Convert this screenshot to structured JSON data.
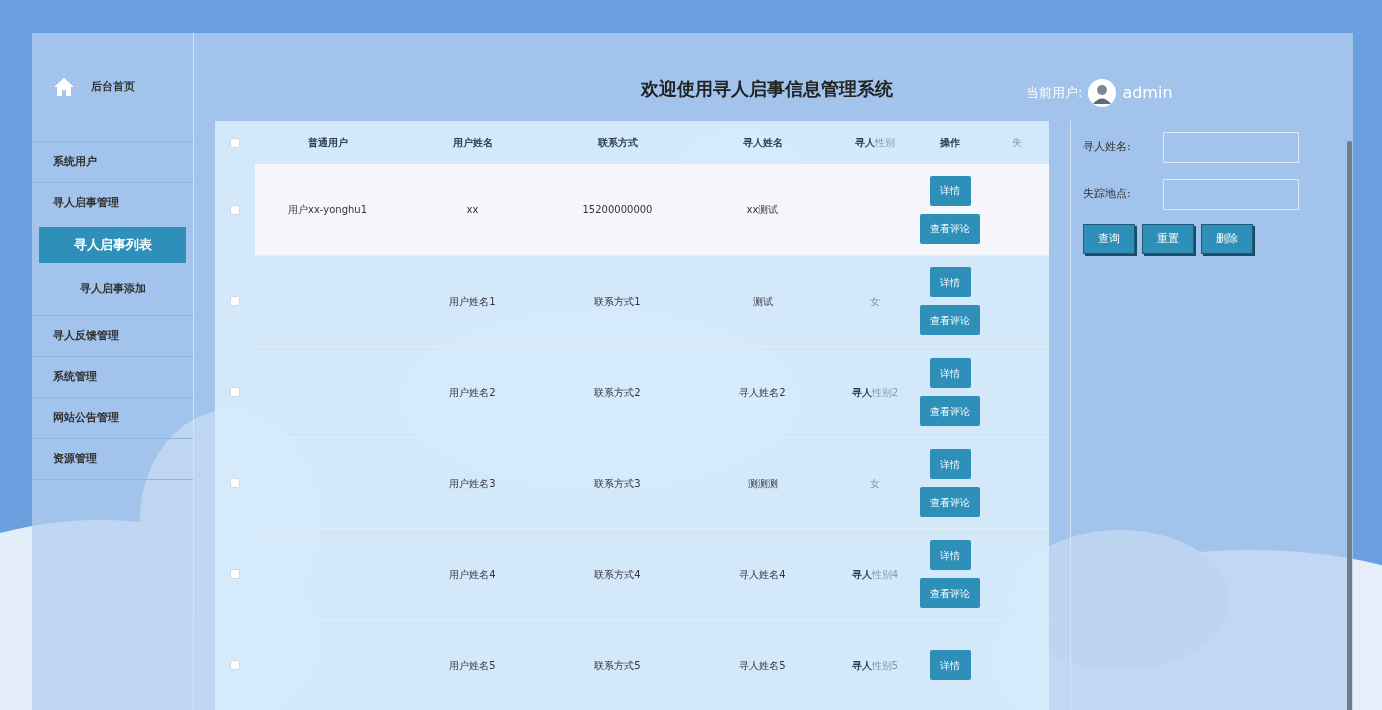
{
  "sidebar": {
    "home": "后台首页",
    "items": [
      {
        "label": "系统用户",
        "selected": false
      },
      {
        "label": "寻人启事管理",
        "selected": false,
        "children": [
          {
            "label": "寻人启事列表",
            "selected": true
          },
          {
            "label": "寻人启事添加",
            "selected": false
          }
        ]
      },
      {
        "label": "寻人反馈管理",
        "selected": false
      },
      {
        "label": "系统管理",
        "selected": false
      },
      {
        "label": "网站公告管理",
        "selected": false
      },
      {
        "label": "资源管理",
        "selected": false
      }
    ]
  },
  "header": {
    "title": "欢迎使用寻人启事信息管理系统",
    "user_label": "当前用户:",
    "user_name": "admin"
  },
  "table": {
    "select_all": {
      "checked": false
    },
    "columns": [
      {
        "label": "普通用户"
      },
      {
        "label": "用户姓名"
      },
      {
        "label": "联系方式"
      },
      {
        "label": "寻人姓名"
      },
      {
        "label": "寻人",
        "faint": "性别"
      },
      {
        "label": "操作"
      },
      {
        "faint": "失"
      }
    ],
    "rows": [
      {
        "selected": true,
        "checked": false,
        "user": "用户xx-yonghu1",
        "name": "xx",
        "contact": "15200000000",
        "missing": "xx测试",
        "actions": [
          "详情",
          "查看评论"
        ]
      },
      {
        "selected": false,
        "checked": false,
        "name": "用户姓名1",
        "contact": "联系方式1",
        "missing": "测试",
        "gender": {
          "faint": "女"
        },
        "actions": [
          "详情",
          "查看评论"
        ]
      },
      {
        "selected": false,
        "checked": false,
        "name": "用户姓名2",
        "contact": "联系方式2",
        "missing": "寻人姓名2",
        "gender": {
          "strong": "寻人",
          "faint": "性别2"
        },
        "actions": [
          "详情",
          "查看评论"
        ]
      },
      {
        "selected": false,
        "checked": false,
        "name": "用户姓名3",
        "contact": "联系方式3",
        "missing": "测测测",
        "gender": {
          "faint": "女"
        },
        "actions": [
          "详情",
          "查看评论"
        ]
      },
      {
        "selected": false,
        "checked": false,
        "name": "用户姓名4",
        "contact": "联系方式4",
        "missing": "寻人姓名4",
        "gender": {
          "strong": "寻人",
          "faint": "性别4"
        },
        "actions": [
          "详情",
          "查看评论"
        ]
      },
      {
        "selected": false,
        "checked": false,
        "name": "用户姓名5",
        "contact": "联系方式5",
        "missing": "寻人姓名5",
        "gender": {
          "strong": "寻人",
          "faint": "性别5"
        },
        "actions": [
          "详情"
        ]
      }
    ]
  },
  "search": {
    "fields": [
      {
        "label": "寻人姓名:"
      },
      {
        "label": "失踪地点:"
      }
    ],
    "buttons": [
      "查询",
      "重置",
      "删除"
    ]
  }
}
